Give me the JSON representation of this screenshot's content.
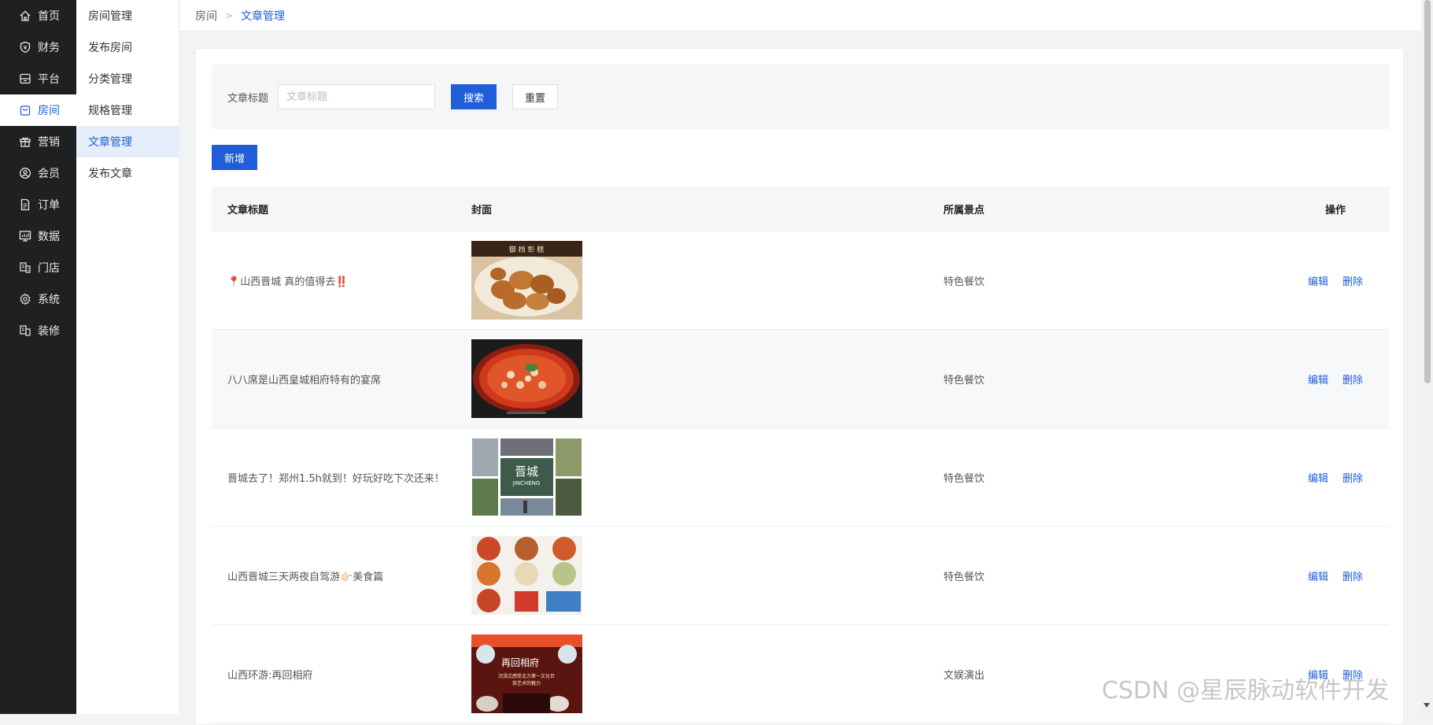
{
  "nav": {
    "items": [
      {
        "label": "首页",
        "icon": "home-icon"
      },
      {
        "label": "财务",
        "icon": "shield-icon"
      },
      {
        "label": "平台",
        "icon": "box-icon"
      },
      {
        "label": "房间",
        "icon": "bag-icon"
      },
      {
        "label": "营销",
        "icon": "gift-icon"
      },
      {
        "label": "会员",
        "icon": "user-circle-icon"
      },
      {
        "label": "订单",
        "icon": "document-icon"
      },
      {
        "label": "数据",
        "icon": "chart-icon"
      },
      {
        "label": "门店",
        "icon": "store-icon"
      },
      {
        "label": "系统",
        "icon": "gear-icon"
      },
      {
        "label": "装修",
        "icon": "layers-icon"
      }
    ],
    "active": "房间"
  },
  "subnav": {
    "items": [
      "房间管理",
      "发布房间",
      "分类管理",
      "规格管理",
      "文章管理",
      "发布文章"
    ],
    "active": "文章管理"
  },
  "breadcrumb": {
    "parent": "房间",
    "separator": ">",
    "current": "文章管理"
  },
  "search": {
    "label": "文章标题",
    "placeholder": "文章标题",
    "value": "",
    "search_button": "搜索",
    "reset_button": "重置"
  },
  "toolbar": {
    "add_button": "新增"
  },
  "table": {
    "columns": [
      "文章标题",
      "封面",
      "所属景点",
      "操作"
    ],
    "rows": [
      {
        "title": "📍山西晋城 真的值得去‼️",
        "spot": "特色餐饮",
        "cover": "pastry-dish-photo"
      },
      {
        "title": "八八席是山西皇城相府特有的宴席",
        "spot": "特色餐饮",
        "cover": "red-soup-dish-photo"
      },
      {
        "title": "晋城去了！郑州1.5h就到！好玩好吃下次还来！",
        "spot": "特色餐饮",
        "cover": "jincheng-collage-photo"
      },
      {
        "title": "山西晋城三天两夜自驾游👉🏻美食篇",
        "spot": "特色餐饮",
        "cover": "food-collage-photo"
      },
      {
        "title": "山西环游:再回相府",
        "spot": "文娱演出",
        "cover": "stage-show-photo"
      }
    ],
    "edit_label": "编辑",
    "delete_label": "删除"
  },
  "cover_texts": {
    "pastry": "御 档 彰 糕",
    "collage_title": "晋城",
    "collage_sub": "JINCHENG",
    "stage_title": "再回相府",
    "stage_sub": "沉浸式感受北方第一文化巨",
    "stage_sub2": "族艺术的魅力"
  },
  "watermark": "CSDN @星辰脉动软件开发",
  "colors": {
    "sidebar_bg": "#1f2021",
    "accent": "#1f5ed8",
    "subnav_active_bg": "#e6edfb",
    "panel_bg": "#f5f6f8"
  }
}
